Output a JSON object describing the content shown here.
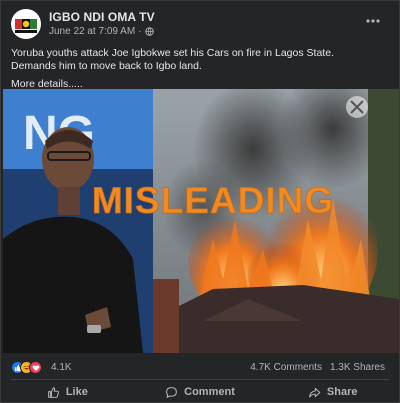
{
  "post": {
    "page_name": "IGBO NDI OMA TV",
    "timestamp": "June 22 at 7:09 AM",
    "separator": "·",
    "caption_line1": "Yoruba youths attack Joe Igbokwe set his Cars on fire in Lagos State.",
    "caption_line2": "Demands him to move back to Igbo land.",
    "more_details": "More details....."
  },
  "photo": {
    "overlay_label": "MISLEADING",
    "backdrop_text": "NG"
  },
  "engagement": {
    "reaction_count": "4.1K",
    "comments": "4.7K Comments",
    "shares": "1.3K Shares",
    "reaction_icons": [
      "like-icon",
      "haha-icon",
      "love-icon"
    ]
  },
  "actions": {
    "like_label": "Like",
    "comment_label": "Comment",
    "share_label": "Share"
  },
  "colors": {
    "card_bg": "#242526",
    "text_primary": "#e4e6eb",
    "text_secondary": "#b0b3b8",
    "misleading_label": "#f08a24",
    "like_blue": "#1877f2",
    "love_red": "#f33e58",
    "haha_yellow": "#f7b125"
  }
}
